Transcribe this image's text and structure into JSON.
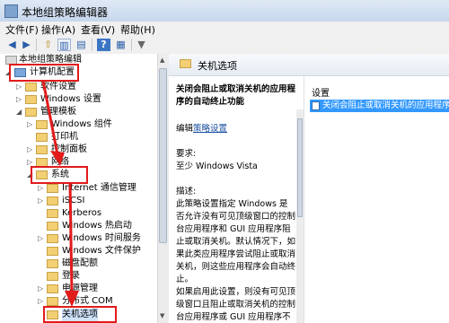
{
  "window": {
    "title": "本地组策略编辑器"
  },
  "menu": [
    "文件(F)",
    "操作(A)",
    "查看(V)",
    "帮助(H)"
  ],
  "toolbar_icons": [
    "back-icon",
    "forward-icon",
    "up-icon",
    "show-hide-tree-icon",
    "properties-icon",
    "help-icon",
    "details-icon",
    "filter-icon"
  ],
  "tree": {
    "root": "本地组策略编辑",
    "items": [
      {
        "label": "计算机配置"
      },
      {
        "label": "软件设置"
      },
      {
        "label": "Windows 设置"
      },
      {
        "label": "管理模板"
      },
      {
        "label": "Windows 组件"
      },
      {
        "label": "打印机"
      },
      {
        "label": "控制面板"
      },
      {
        "label": "网络"
      },
      {
        "label": "系统"
      },
      {
        "label": "Internet 通信管理"
      },
      {
        "label": "iSCSI"
      },
      {
        "label": "Kerberos"
      },
      {
        "label": "Windows 热启动"
      },
      {
        "label": "Windows 时间服务"
      },
      {
        "label": "Windows 文件保护"
      },
      {
        "label": "磁盘配额"
      },
      {
        "label": "登录"
      },
      {
        "label": "电源管理"
      },
      {
        "label": "分布式 COM"
      },
      {
        "label": "关机选项"
      }
    ]
  },
  "right": {
    "header": "关机选项",
    "desc_title": "关闭会阻止或取消关机的应用程序的自动终止功能",
    "edit_prefix": "编辑",
    "edit_link": "策略设置",
    "req_label": "要求:",
    "req_value": "至少 Windows Vista",
    "desc_label": "描述:",
    "desc_p1": "此策略设置指定 Windows 是否允许没有可见顶级窗口的控制台应用程序和 GUI 应用程序阻止或取消关机。默认情况下，如果此类应用程序尝试阻止或取消关机，则这些应用程序会自动终止。",
    "desc_p2": "如果启用此设置，则没有可见顶级窗口且阻止或取消关机的控制台应用程序或 GUI 应用程序不会在关机期间自动终止。",
    "list_header": "设置",
    "list_item": "关闭会阻止或取消关机的应用程序的"
  }
}
